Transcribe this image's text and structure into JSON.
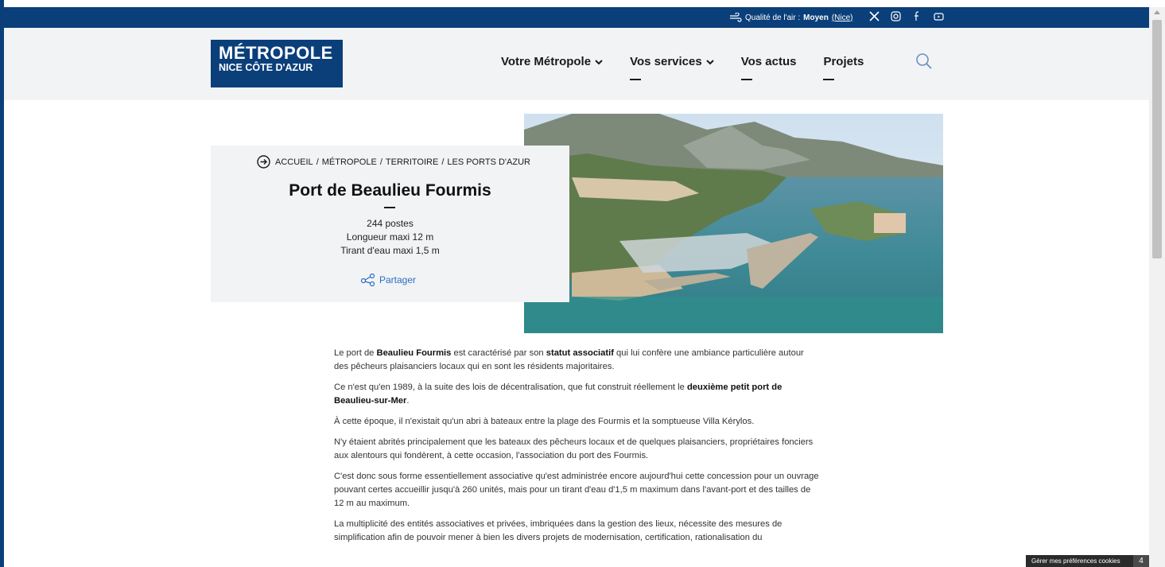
{
  "topbar": {
    "air_label": "Qualité de l'air :",
    "air_level": "Moyen",
    "air_city": "(Nice)",
    "social_icons": [
      "x-icon",
      "instagram-icon",
      "facebook-icon",
      "youtube-icon"
    ]
  },
  "header": {
    "logo_line1": "MÉTROPOLE",
    "logo_line2": "NICE CÔTE D'AZUR",
    "nav": [
      {
        "label": "Votre Métropole",
        "has_dropdown": true
      },
      {
        "label": "Vos services",
        "has_dropdown": true
      },
      {
        "label": "Vos actus",
        "has_dropdown": false
      },
      {
        "label": "Projets",
        "has_dropdown": false
      }
    ]
  },
  "hero": {
    "breadcrumb": [
      "Accueil",
      "Métropole",
      "Territoire",
      "Les ports d'Azur"
    ],
    "title": "Port de Beaulieu Fourmis",
    "facts": [
      "244 postes",
      "Longueur maxi 12 m",
      "Tirant d'eau maxi 1,5 m"
    ],
    "share_label": "Partager"
  },
  "article": {
    "p1_a": "Le port de ",
    "p1_b": "Beaulieu Fourmis",
    "p1_c": " est caractérisé par son ",
    "p1_d": "statut associatif",
    "p1_e": " qui lui confère une ambiance particulière autour des pêcheurs plaisanciers locaux qui en sont les résidents majoritaires.",
    "p2_a": "Ce n'est qu'en 1989, à la suite des lois de décentralisation, que fut construit réellement le ",
    "p2_b": "deuxième petit port de Beaulieu-sur-Mer",
    "p2_c": ".",
    "p3": "À cette époque, il n'existait qu'un abri à bateaux entre la plage des Fourmis et la somptueuse Villa Kérylos.",
    "p4": "N'y étaient abrités principalement que les bateaux des pêcheurs locaux et de quelques plaisanciers, propriétaires fonciers aux alentours qui fondèrent, à cette occasion, l'association du port des Fourmis.",
    "p5": "C'est donc sous forme essentiellement associative qu'est administrée encore aujourd'hui cette concession pour un ouvrage pouvant certes accueillir jusqu'à 260 unités, mais pour un tirant d'eau d'1,5 m maximum dans l'avant-port et des tailles de 12 m au maximum.",
    "p6": "La multiplicité des entités associatives et privées, imbriquées dans la gestion des lieux, nécessite des mesures de simplification afin de pouvoir mener à bien les divers projets de modernisation, certification, rationalisation du"
  },
  "cookies": {
    "label": "Gérer mes préférences cookies",
    "count": "4"
  }
}
